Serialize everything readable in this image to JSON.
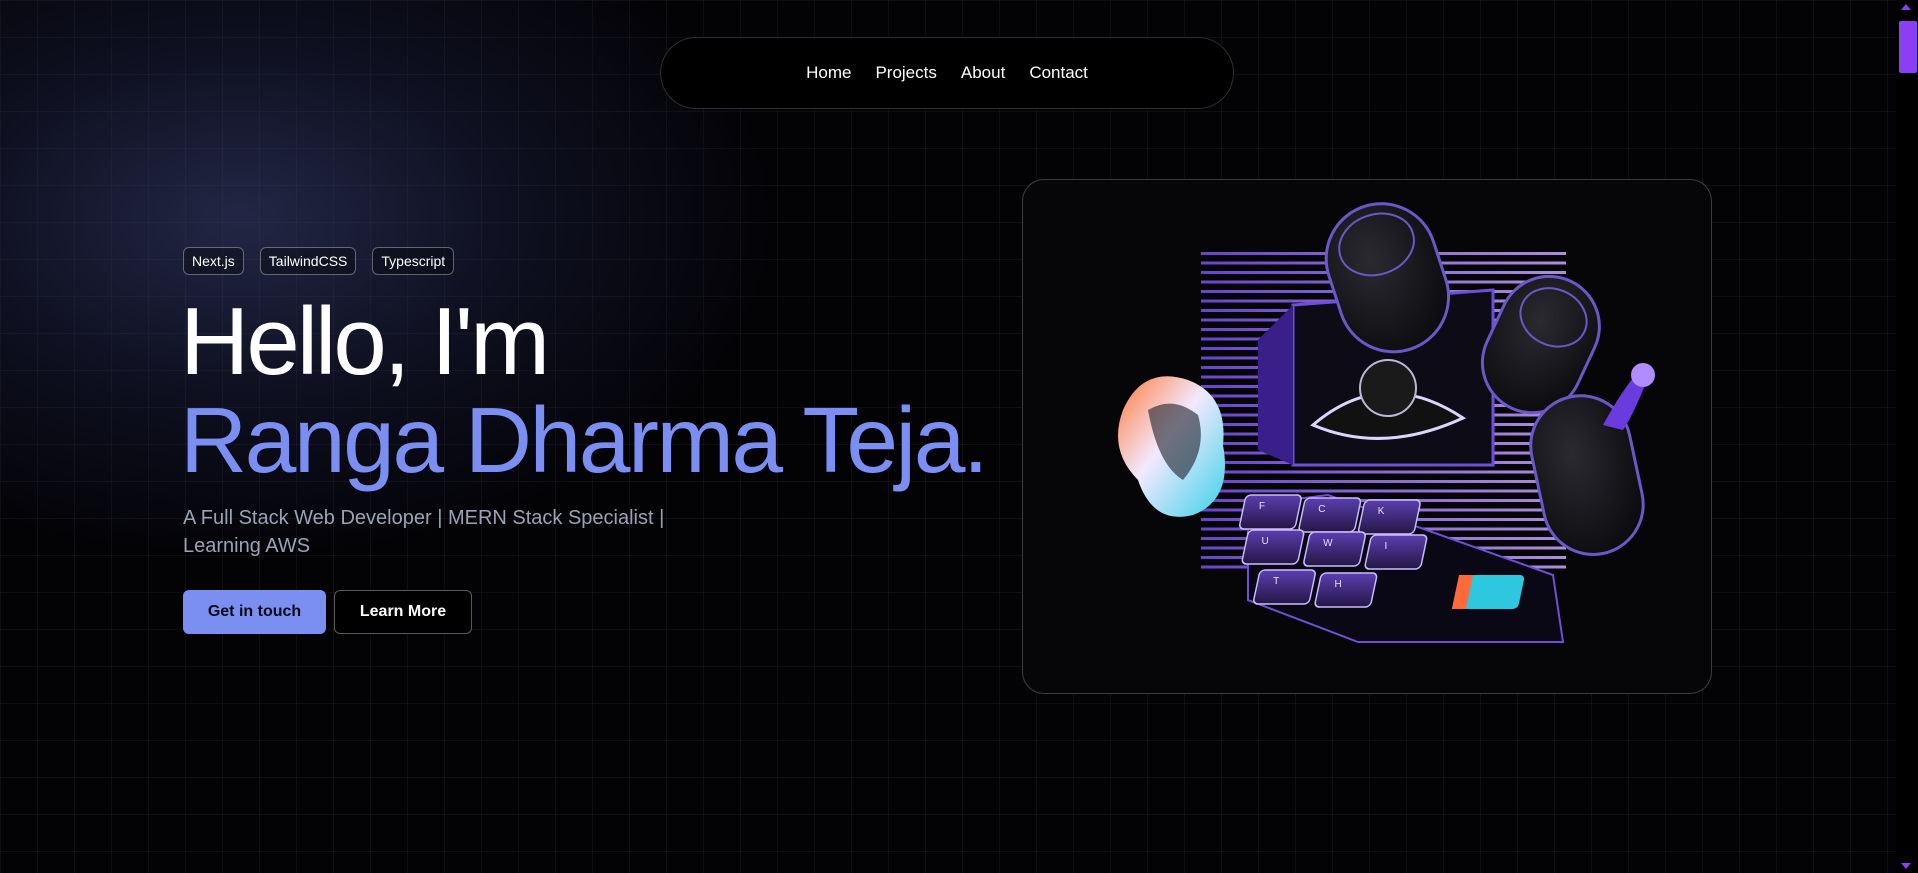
{
  "nav": {
    "items": [
      {
        "label": "Home"
      },
      {
        "label": "Projects"
      },
      {
        "label": "About"
      },
      {
        "label": "Contact"
      }
    ]
  },
  "hero": {
    "tags": [
      "Next.js",
      "TailwindCSS",
      "Typescript"
    ],
    "greeting": "Hello, I'm",
    "name": "Ranga Dharma Teja.",
    "subtitle_line1": "A Full Stack Web Developer | MERN Stack Specialist |",
    "subtitle_line2": "Learning AWS",
    "primary_button": "Get in touch",
    "secondary_button": "Learn More"
  },
  "illustration": {
    "icon": "keyboard-eye-illustration",
    "key_letters": [
      "F",
      "C",
      "K",
      "U",
      "W",
      "I",
      "T",
      "H"
    ]
  },
  "colors": {
    "accent": "#7b8ff2",
    "scrollbar": "#8a3ff0",
    "background": "#030306"
  }
}
